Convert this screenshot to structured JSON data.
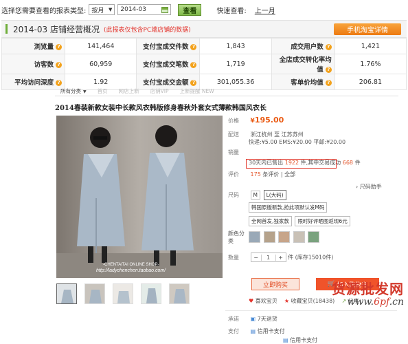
{
  "filter": {
    "report_type_label": "选择您需要查看的报表类型:",
    "period_value": "按月",
    "date_value": "2014-03",
    "view_button": "查看",
    "quick_label": "快速查看:",
    "prev_month_link": "上一月"
  },
  "section": {
    "title": "2014-03 店铺经营概况",
    "note": "(此报表仅包含PC端店铺的数据)",
    "mobile_button": "手机淘宝详情"
  },
  "stats": [
    [
      {
        "k": "浏览量",
        "v": "141,464"
      },
      {
        "k": "支付宝成交件数",
        "v": "1,843"
      },
      {
        "k": "成交用户数",
        "v": "1,421"
      }
    ],
    [
      {
        "k": "访客数",
        "v": "60,959"
      },
      {
        "k": "支付宝成交笔数",
        "v": "1,719"
      },
      {
        "k": "全店成交转化率均值",
        "v": "1.76%"
      }
    ],
    [
      {
        "k": "平均访问深度",
        "v": "1.92"
      },
      {
        "k": "支付宝成交金额",
        "v": "301,055.36"
      },
      {
        "k": "客单价均值",
        "v": "206.81"
      }
    ]
  ],
  "product": {
    "tabs": [
      "所有分类",
      "首页",
      "网店上新",
      "店铺VIP",
      "上新提醒 NEW"
    ],
    "title": "2014春装新款女装中长款风衣韩版修身春秋外套女式薄款韩国风衣长",
    "price_label": "价格",
    "price": "195.00",
    "currency": "¥",
    "shipping_label": "配送",
    "shipping_route": "浙江杭州 至 江苏苏州",
    "shipping_fees": "快递:¥5.00  EMS:¥20.00  平邮:¥20.00",
    "sales_label": "销量",
    "sold_prefix": "30天内已售出",
    "sold_count": "1922",
    "sold_unit": "件,",
    "deal_prefix": "其中交易成功",
    "deal_count": "668",
    "deal_unit": "件",
    "rating_label": "评价",
    "review_count": "175",
    "review_suffix": "条评价",
    "review_all": "全部",
    "size_label": "尺码",
    "size_options": [
      "M",
      "L(大码)"
    ],
    "size_helper": "尺码助手",
    "promo_tags": [
      "韩国原版新款,抢此项默认发M码",
      "全网首发,独家款",
      "限时好评晒图返现6元"
    ],
    "color_label": "颜色分类",
    "qty_label": "数量",
    "qty_value": "1",
    "stock_text": "件 (库存15010件)",
    "buy_button": "立即购买",
    "cart_button": "加入购物车",
    "like_label": "喜欢宝贝",
    "fav_label": "收藏宝贝",
    "fav_count": "(18438)",
    "share_label": "分享",
    "promise_label": "承诺",
    "promise_value": "7天退货",
    "pay_label": "支付",
    "pay_credit": "信用卡支付",
    "pay_card": "信用卡支付",
    "watermark_shop": "-CHENTAITAI ONLINE SHOP-",
    "watermark_url": "http://ladychenchen.taobao.com/"
  },
  "watermark": {
    "cn_big": "货源批发网",
    "url_pre": "www.",
    "url_num": "6pf",
    "url_post": ".cn"
  }
}
